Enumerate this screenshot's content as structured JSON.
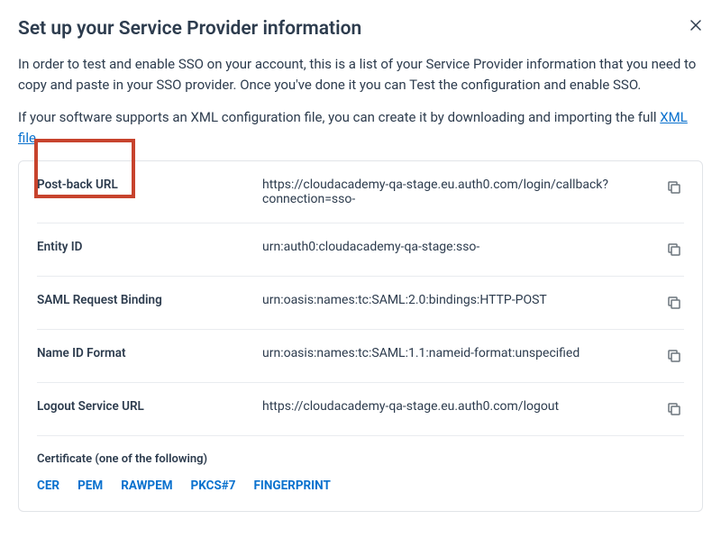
{
  "title": "Set up your Service Provider information",
  "description1": "In order to test and enable SSO on your account, this is a list of your Service Provider information that you need to copy and paste in your SSO provider. Once you've done it you can Test the configuration and enable SSO.",
  "description2_pre": "If your software supports an XML configuration file, you can create it by downloading and importing the full ",
  "description2_link": "XML file",
  "description2_post": ".",
  "rows": [
    {
      "label": "Post-back URL",
      "value": "https://cloudacademy-qa-stage.eu.auth0.com/login/callback?connection=sso-"
    },
    {
      "label": "Entity ID",
      "value": "urn:auth0:cloudacademy-qa-stage:sso-"
    },
    {
      "label": "SAML Request Binding",
      "value": "urn:oasis:names:tc:SAML:2.0:bindings:HTTP-POST"
    },
    {
      "label": "Name ID Format",
      "value": "urn:oasis:names:tc:SAML:1.1:nameid-format:unspecified"
    },
    {
      "label": "Logout Service URL",
      "value": "https://cloudacademy-qa-stage.eu.auth0.com/logout"
    }
  ],
  "cert_label": "Certificate (one of the following)",
  "cert_links": [
    "CER",
    "PEM",
    "RAWPEM",
    "PKCS#7",
    "FINGERPRINT"
  ]
}
